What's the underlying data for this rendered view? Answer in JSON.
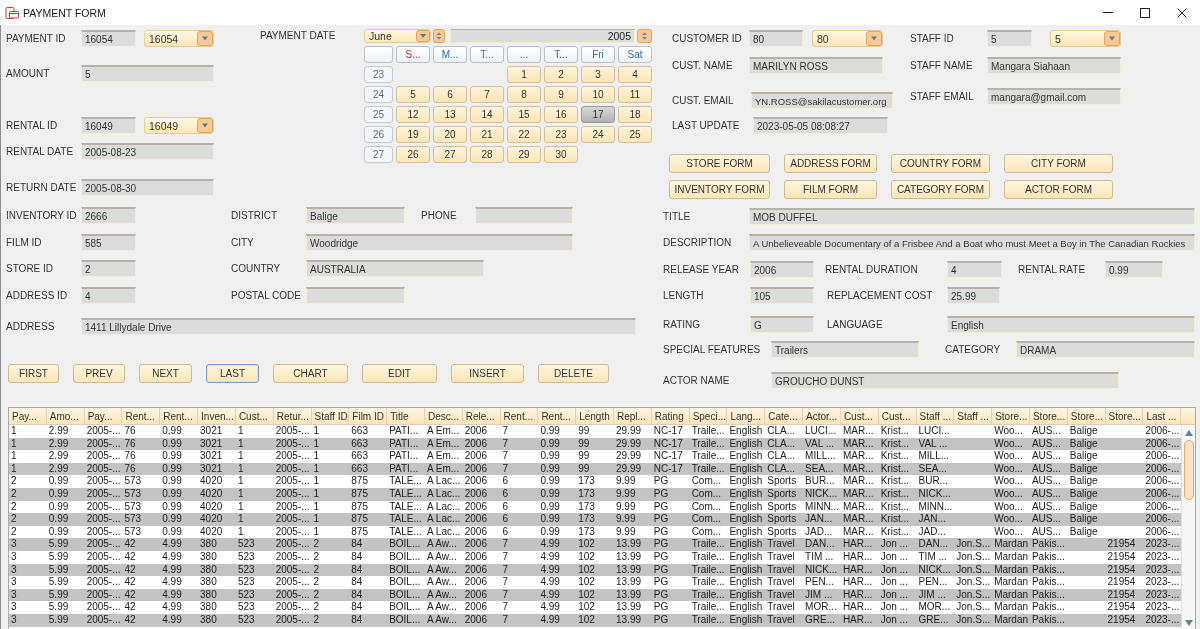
{
  "window": {
    "title": "PAYMENT FORM"
  },
  "payment": {
    "fields": [
      {
        "label": "PAYMENT ID",
        "value": "16054",
        "dropdown_value": "16054"
      },
      {
        "label": "AMOUNT",
        "value": "5"
      },
      {
        "label": "RENTAL ID",
        "value": "16049",
        "dropdown_value": "16049"
      },
      {
        "label": "RENTAL DATE",
        "value": "2005-08-23"
      },
      {
        "label": "RETURN DATE",
        "value": "2005-08-30"
      }
    ]
  },
  "payment_date": {
    "label": "PAYMENT DATE",
    "month": "June",
    "year": "2005",
    "weekdays": [
      "S...",
      "M...",
      "T...",
      "...",
      "T...",
      "Fri",
      "Sat"
    ],
    "weeks": [
      {
        "number": "23",
        "days": [
          {
            "label": "1",
            "selected": false
          },
          {
            "label": "2",
            "selected": false
          },
          {
            "label": "3",
            "selected": false
          },
          {
            "label": "4",
            "selected": false
          }
        ]
      },
      {
        "number": "24",
        "days": [
          {
            "label": "5",
            "selected": false
          },
          {
            "label": "6",
            "selected": false
          },
          {
            "label": "7",
            "selected": false
          },
          {
            "label": "8",
            "selected": false
          },
          {
            "label": "9",
            "selected": false
          },
          {
            "label": "10",
            "selected": false
          },
          {
            "label": "11",
            "selected": false
          }
        ]
      },
      {
        "number": "25",
        "days": [
          {
            "label": "12",
            "selected": false
          },
          {
            "label": "13",
            "selected": false
          },
          {
            "label": "14",
            "selected": false
          },
          {
            "label": "15",
            "selected": false
          },
          {
            "label": "16",
            "selected": false
          },
          {
            "label": "17",
            "selected": true
          },
          {
            "label": "18",
            "selected": false
          }
        ]
      },
      {
        "number": "26",
        "days": [
          {
            "label": "19",
            "selected": false
          },
          {
            "label": "20",
            "selected": false
          },
          {
            "label": "21",
            "selected": false
          },
          {
            "label": "22",
            "selected": false
          },
          {
            "label": "23",
            "selected": false
          },
          {
            "label": "24",
            "selected": false
          },
          {
            "label": "25",
            "selected": false
          }
        ]
      },
      {
        "number": "27",
        "days": [
          {
            "label": "26",
            "selected": false
          },
          {
            "label": "27",
            "selected": false
          },
          {
            "label": "28",
            "selected": false
          },
          {
            "label": "29",
            "selected": false
          },
          {
            "label": "30",
            "selected": false
          }
        ]
      }
    ]
  },
  "customer": {
    "fields": [
      {
        "label": "CUSTOMER ID",
        "value": "80",
        "dropdown_value": "80"
      },
      {
        "label": "CUST. NAME",
        "value": "MARILYN ROSS"
      },
      {
        "label": "CUST. EMAIL",
        "value": "YN.ROSS@sakilacustomer.org"
      },
      {
        "label": "LAST UPDATE",
        "value": "2023-05-05 08:08:27"
      }
    ]
  },
  "staff": {
    "fields": [
      {
        "label": "STAFF ID",
        "value": "5",
        "dropdown_value": "5"
      },
      {
        "label": "STAFF NAME",
        "value": "Mangara Siahaan"
      },
      {
        "label": "STAFF EMAIL",
        "value": "mangara@gmail.com"
      }
    ]
  },
  "form_buttons": [
    "STORE FORM",
    "ADDRESS FORM",
    "COUNTRY FORM",
    "CITY FORM",
    "INVENTORY FORM",
    "FILM FORM",
    "CATEGORY FORM",
    "ACTOR FORM"
  ],
  "inventory": {
    "fields": [
      {
        "label": "INVENTORY ID",
        "value": "2666"
      },
      {
        "label": "FILM ID",
        "value": "585"
      },
      {
        "label": "STORE ID",
        "value": "2"
      },
      {
        "label": "ADDRESS ID",
        "value": "4"
      }
    ]
  },
  "address": {
    "fields": [
      {
        "label": "DISTRICT",
        "value": "Balige"
      },
      {
        "label": "PHONE"
      },
      {
        "label": "CITY",
        "value": "Woodridge"
      },
      {
        "label": "COUNTRY",
        "value": "AUSTRALIA"
      },
      {
        "label": "POSTAL CODE"
      }
    ],
    "address_line": {
      "label": "ADDRESS",
      "value": "1411 Lillydale Drive"
    }
  },
  "film": {
    "fields": [
      {
        "label": "TITLE",
        "value": "MOB DUFFEL"
      },
      {
        "label": "DESCRIPTION",
        "value": "A Unbelieveable Documentary of a Frisbee And a Boat who must Meet a Boy in The Canadian Rockies"
      },
      {
        "label": "RELEASE YEAR",
        "value": "2006"
      },
      {
        "label": "RENTAL DURATION",
        "value": "4"
      },
      {
        "label": "RENTAL RATE",
        "value": "0.99"
      },
      {
        "label": "LENGTH",
        "value": "105"
      },
      {
        "label": "REPLACEMENT COST",
        "value": "25.99"
      },
      {
        "label": "RATING",
        "value": "G"
      },
      {
        "label": "LANGUAGE",
        "value": "English"
      },
      {
        "label": "SPECIAL FEATURES",
        "value": "Trailers"
      },
      {
        "label": "CATEGORY",
        "value": "DRAMA"
      },
      {
        "label": "ACTOR NAME",
        "value": "GROUCHO DUNST"
      }
    ]
  },
  "nav_buttons": [
    {
      "label": "FIRST",
      "focused": false
    },
    {
      "label": "PREV",
      "focused": false
    },
    {
      "label": "NEXT",
      "focused": false
    },
    {
      "label": "LAST",
      "focused": true
    },
    {
      "label": "CHART",
      "focused": false
    },
    {
      "label": "EDIT",
      "focused": false
    },
    {
      "label": "INSERT",
      "focused": false
    },
    {
      "label": "DELETE",
      "focused": false
    }
  ],
  "table": {
    "columns": [
      "Pay...",
      "Amo...",
      "Pay...",
      "Rent...",
      "Rent...",
      "Inven...",
      "Cust...",
      "Retur...",
      "Staff ID",
      "Film ID",
      "Title",
      "Desc...",
      "Rele...",
      "Rent...",
      "Rent...",
      "Length",
      "Repl...",
      "Rating",
      "Speci...",
      "Lang...",
      "Cate...",
      "Actor...",
      "Cust...",
      "Cust...",
      "Staff ...",
      "Staff ...",
      "Store...",
      "Store...",
      "Store...",
      "Store...",
      "Last ..."
    ],
    "rows": [
      [
        "1",
        "2.99",
        "2005-...",
        "76",
        "0.99",
        "3021",
        "1",
        "2005-...",
        "1",
        "663",
        "PATI...",
        "A Em...",
        "2006",
        "7",
        "0.99",
        "99",
        "29.99",
        "NC-17",
        "Traile...",
        "English",
        "CLA...",
        "LUCI...",
        "MAR...",
        "Krist...",
        "LUCI...",
        null,
        "Woo...",
        "AUS...",
        "Balige",
        null,
        "2006-..."
      ],
      [
        "1",
        "2.99",
        "2005-...",
        "76",
        "0.99",
        "3021",
        "1",
        "2005-...",
        "1",
        "663",
        "PATI...",
        "A Em...",
        "2006",
        "7",
        "0.99",
        "99",
        "29.99",
        "NC-17",
        "Traile...",
        "English",
        "CLA...",
        "VAL ...",
        "MAR...",
        "Krist...",
        "VAL ...",
        null,
        "Woo...",
        "AUS...",
        "Balige",
        null,
        "2006-..."
      ],
      [
        "1",
        "2.99",
        "2005-...",
        "76",
        "0.99",
        "3021",
        "1",
        "2005-...",
        "1",
        "663",
        "PATI...",
        "A Em...",
        "2006",
        "7",
        "0.99",
        "99",
        "29.99",
        "NC-17",
        "Traile...",
        "English",
        "CLA...",
        "MILL...",
        "MAR...",
        "Krist...",
        "MILL...",
        null,
        "Woo...",
        "AUS...",
        "Balige",
        null,
        "2006-..."
      ],
      [
        "1",
        "2.99",
        "2005-...",
        "76",
        "0.99",
        "3021",
        "1",
        "2005-...",
        "1",
        "663",
        "PATI...",
        "A Em...",
        "2006",
        "7",
        "0.99",
        "99",
        "29.99",
        "NC-17",
        "Traile...",
        "English",
        "CLA...",
        "SEA...",
        "MAR...",
        "Krist...",
        "SEA...",
        null,
        "Woo...",
        "AUS...",
        "Balige",
        null,
        "2006-..."
      ],
      [
        "2",
        "0.99",
        "2005-...",
        "573",
        "0.99",
        "4020",
        "1",
        "2005-...",
        "1",
        "875",
        "TALE...",
        "A Lac...",
        "2006",
        "6",
        "0.99",
        "173",
        "9.99",
        "PG",
        "Com...",
        "English",
        "Sports",
        "BUR...",
        "MAR...",
        "Krist...",
        "BUR...",
        null,
        "Woo...",
        "AUS...",
        "Balige",
        null,
        "2006-..."
      ],
      [
        "2",
        "0.99",
        "2005-...",
        "573",
        "0.99",
        "4020",
        "1",
        "2005-...",
        "1",
        "875",
        "TALE...",
        "A Lac...",
        "2006",
        "6",
        "0.99",
        "173",
        "9.99",
        "PG",
        "Com...",
        "English",
        "Sports",
        "NICK...",
        "MAR...",
        "Krist...",
        "NICK...",
        null,
        "Woo...",
        "AUS...",
        "Balige",
        null,
        "2006-..."
      ],
      [
        "2",
        "0.99",
        "2005-...",
        "573",
        "0.99",
        "4020",
        "1",
        "2005-...",
        "1",
        "875",
        "TALE...",
        "A Lac...",
        "2006",
        "6",
        "0.99",
        "173",
        "9.99",
        "PG",
        "Com...",
        "English",
        "Sports",
        "MINN...",
        "MAR...",
        "Krist...",
        "MINN...",
        null,
        "Woo...",
        "AUS...",
        "Balige",
        null,
        "2006-..."
      ],
      [
        "2",
        "0.99",
        "2005-...",
        "573",
        "0.99",
        "4020",
        "1",
        "2005-...",
        "1",
        "875",
        "TALE...",
        "A Lac...",
        "2006",
        "6",
        "0.99",
        "173",
        "9.99",
        "PG",
        "Com...",
        "English",
        "Sports",
        "JAN...",
        "MAR...",
        "Krist...",
        "JAN...",
        null,
        "Woo...",
        "AUS...",
        "Balige",
        null,
        "2006-..."
      ],
      [
        "2",
        "0.99",
        "2005-...",
        "573",
        "0.99",
        "4020",
        "1",
        "2005-...",
        "1",
        "875",
        "TALE...",
        "A Lac...",
        "2006",
        "6",
        "0.99",
        "173",
        "9.99",
        "PG",
        "Com...",
        "English",
        "Sports",
        "JAD...",
        "MAR...",
        "Krist...",
        "JAD...",
        null,
        "Woo...",
        "AUS...",
        "Balige",
        null,
        "2006-..."
      ],
      [
        "3",
        "5.99",
        "2005-...",
        "42",
        "4.99",
        "380",
        "523",
        "2005-...",
        "2",
        "84",
        "BOIL...",
        "A Aw...",
        "2006",
        "7",
        "4.99",
        "102",
        "13.99",
        "PG",
        "Traile...",
        "English",
        "Travel",
        "DAN...",
        "HAR...",
        "Jon ...",
        "DAN...",
        "Jon.S...",
        "Mardan",
        "Pakis...",
        null,
        "21954",
        "2023-..."
      ],
      [
        "3",
        "5.99",
        "2005-...",
        "42",
        "4.99",
        "380",
        "523",
        "2005-...",
        "2",
        "84",
        "BOIL...",
        "A Aw...",
        "2006",
        "7",
        "4.99",
        "102",
        "13.99",
        "PG",
        "Traile...",
        "English",
        "Travel",
        "TIM ...",
        "HAR...",
        "Jon ...",
        "TIM ...",
        "Jon.S...",
        "Mardan",
        "Pakis...",
        null,
        "21954",
        "2023-..."
      ],
      [
        "3",
        "5.99",
        "2005-...",
        "42",
        "4.99",
        "380",
        "523",
        "2005-...",
        "2",
        "84",
        "BOIL...",
        "A Aw...",
        "2006",
        "7",
        "4.99",
        "102",
        "13.99",
        "PG",
        "Traile...",
        "English",
        "Travel",
        "NICK...",
        "HAR...",
        "Jon ...",
        "NICK...",
        "Jon.S...",
        "Mardan",
        "Pakis...",
        null,
        "21954",
        "2023-..."
      ],
      [
        "3",
        "5.99",
        "2005-...",
        "42",
        "4.99",
        "380",
        "523",
        "2005-...",
        "2",
        "84",
        "BOIL...",
        "A Aw...",
        "2006",
        "7",
        "4.99",
        "102",
        "13.99",
        "PG",
        "Traile...",
        "English",
        "Travel",
        "PEN...",
        "HAR...",
        "Jon ...",
        "PEN...",
        "Jon.S...",
        "Mardan",
        "Pakis...",
        null,
        "21954",
        "2023-..."
      ],
      [
        "3",
        "5.99",
        "2005-...",
        "42",
        "4.99",
        "380",
        "523",
        "2005-...",
        "2",
        "84",
        "BOIL...",
        "A Aw...",
        "2006",
        "7",
        "4.99",
        "102",
        "13.99",
        "PG",
        "Traile...",
        "English",
        "Travel",
        "JIM ...",
        "HAR...",
        "Jon ...",
        "JIM ...",
        "Jon.S...",
        "Mardan",
        "Pakis...",
        null,
        "21954",
        "2023-..."
      ],
      [
        "3",
        "5.99",
        "2005-...",
        "42",
        "4.99",
        "380",
        "523",
        "2005-...",
        "2",
        "84",
        "BOIL...",
        "A Aw...",
        "2006",
        "7",
        "4.99",
        "102",
        "13.99",
        "PG",
        "Traile...",
        "English",
        "Travel",
        "MOR...",
        "HAR...",
        "Jon ...",
        "MOR...",
        "Jon.S...",
        "Mardan",
        "Pakis...",
        null,
        "21954",
        "2023-..."
      ],
      [
        "3",
        "5.99",
        "2005-...",
        "42",
        "4.99",
        "380",
        "523",
        "2005-...",
        "2",
        "84",
        "BOIL...",
        "A Aw...",
        "2006",
        "7",
        "4.99",
        "102",
        "13.99",
        "PG",
        "Traile...",
        "English",
        "Travel",
        "GRE...",
        "HAR...",
        "Jon ...",
        "GRE...",
        "Jon.S...",
        "Mardan",
        "Pakis...",
        null,
        "21954",
        "2023-..."
      ]
    ]
  }
}
